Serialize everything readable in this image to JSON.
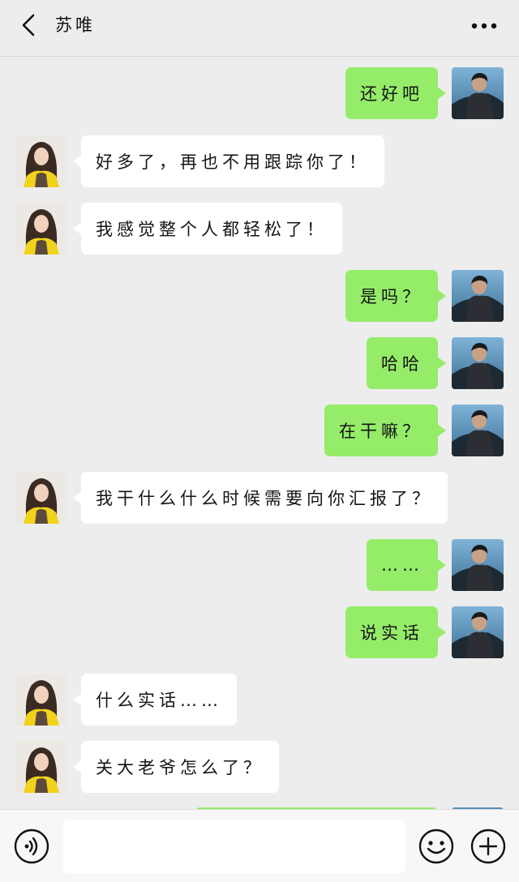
{
  "header": {
    "title": "苏唯",
    "back_icon": "chevron-left-icon",
    "more_icon": "more-dots-icon"
  },
  "messages": [
    {
      "side": "sent",
      "text": "还好吧"
    },
    {
      "side": "recv",
      "text": "好多了，再也不用跟踪你了！"
    },
    {
      "side": "recv",
      "text": "我感觉整个人都轻松了！"
    },
    {
      "side": "sent",
      "text": "是吗？"
    },
    {
      "side": "sent",
      "text": "哈哈"
    },
    {
      "side": "sent",
      "text": "在干嘛？"
    },
    {
      "side": "recv",
      "text": "我干什么什么时候需要向你汇报了？"
    },
    {
      "side": "sent",
      "text": "……"
    },
    {
      "side": "sent",
      "text": "说实话"
    },
    {
      "side": "recv",
      "text": "什么实话……"
    },
    {
      "side": "recv",
      "text": "关大老爷怎么了？"
    }
  ],
  "input_bar": {
    "placeholder": "",
    "voice_icon": "voice-icon",
    "emoji_icon": "emoji-icon",
    "plus_icon": "plus-icon"
  },
  "colors": {
    "background": "#ededed",
    "sent_bubble": "#95ec69",
    "received_bubble": "#ffffff"
  }
}
